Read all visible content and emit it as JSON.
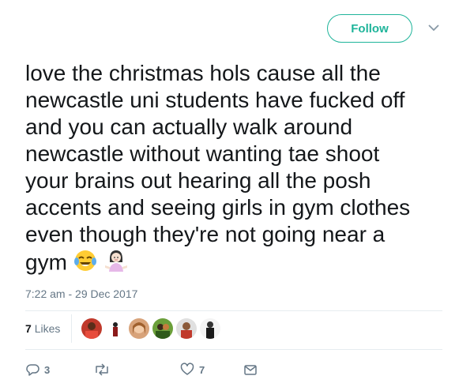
{
  "header": {
    "follow_label": "Follow",
    "menu_icon": "chevron-down-icon"
  },
  "tweet": {
    "lines": [
      "love the christmas hols cause all the",
      "newcastle uni students have fucked off",
      "and you can actually walk around",
      "newcastle without wanting tae shoot",
      "your brains out hearing all the posh",
      "accents and seeing girls in gym clothes",
      "even though they're not going near a",
      "gym"
    ],
    "emojis": [
      "face-with-tears-of-joy-emoji",
      "woman-shrugging-emoji"
    ],
    "timestamp": "7:22 am - 29 Dec 2017"
  },
  "stats": {
    "likes_count": "7",
    "likes_label": "Likes",
    "avatar_count": 6
  },
  "actions": {
    "replies": "3",
    "retweets": "",
    "likes": "7"
  },
  "colors": {
    "accent": "#1fb49a",
    "muted": "#657786",
    "divider": "#e6ecf0",
    "text": "#14171a"
  }
}
